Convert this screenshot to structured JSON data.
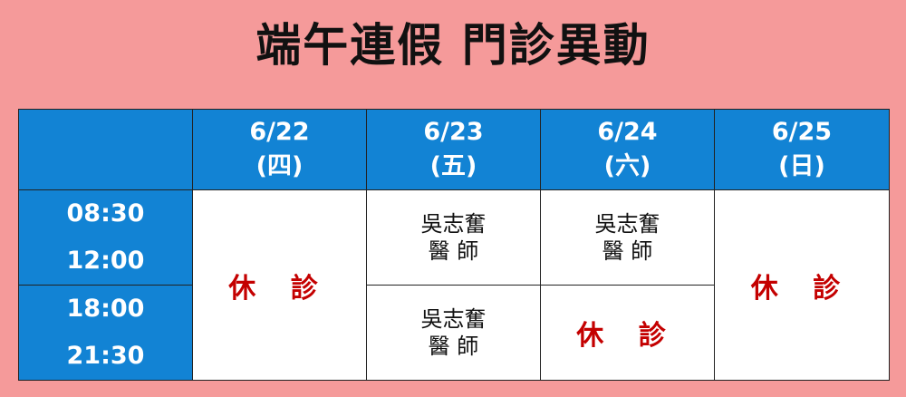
{
  "title": "端午連假 門診異動",
  "headers": [
    {
      "date": "6/22",
      "day": "(四)"
    },
    {
      "date": "6/23",
      "day": "(五)"
    },
    {
      "date": "6/24",
      "day": "(六)"
    },
    {
      "date": "6/25",
      "day": "(日)"
    }
  ],
  "slots": [
    {
      "start": "08:30",
      "end": "12:00"
    },
    {
      "start": "18:00",
      "end": "21:30"
    }
  ],
  "rest_label": "休 診",
  "doctor": {
    "name": "吳志奮",
    "title": "醫 師"
  },
  "colors": {
    "background": "#f59a9a",
    "header": "#1283d4",
    "rest_text": "#c40000"
  }
}
